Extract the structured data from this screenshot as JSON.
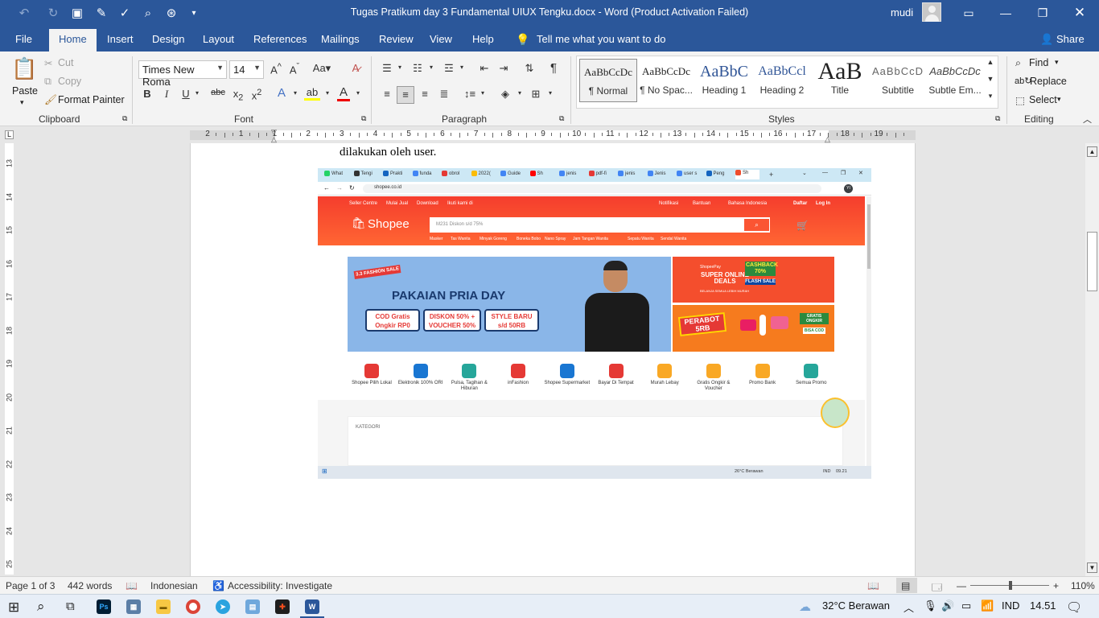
{
  "window": {
    "title": "Tugas Pratikum day 3 Fundamental UIUX Tengku.docx  -  Word (Product Activation Failed)",
    "user": "mudi"
  },
  "tabs": [
    "File",
    "Home",
    "Insert",
    "Design",
    "Layout",
    "References",
    "Mailings",
    "Review",
    "View",
    "Help"
  ],
  "tell_me": "Tell me what you want to do",
  "share": "Share",
  "clipboard": {
    "paste": "Paste",
    "cut": "Cut",
    "copy": "Copy",
    "format_painter": "Format Painter",
    "label": "Clipboard"
  },
  "font": {
    "name": "Times New Roma",
    "size": "14",
    "label": "Font"
  },
  "paragraph": {
    "label": "Paragraph"
  },
  "styles": {
    "label": "Styles",
    "items": [
      {
        "sample": "AaBbCcDc",
        "name": "¶ Normal"
      },
      {
        "sample": "AaBbCcDc",
        "name": "¶ No Spac..."
      },
      {
        "sample": "AaBbC",
        "name": "Heading 1"
      },
      {
        "sample": "AaBbCcl",
        "name": "Heading 2"
      },
      {
        "sample": "AaB",
        "name": "Title"
      },
      {
        "sample": "AaBbCcD",
        "name": "Subtitle"
      },
      {
        "sample": "AaBbCcDc",
        "name": "Subtle Em..."
      }
    ]
  },
  "editing": {
    "find": "Find",
    "replace": "Replace",
    "select": "Select",
    "label": "Editing"
  },
  "ruler": {
    "numbers": [
      "2",
      "1",
      "1",
      "2",
      "3",
      "4",
      "5",
      "6",
      "7",
      "8",
      "9",
      "10",
      "11",
      "12",
      "13",
      "14",
      "15",
      "16",
      "17",
      "18",
      "19"
    ]
  },
  "vruler": {
    "numbers": [
      "13",
      "14",
      "15",
      "16",
      "17",
      "18",
      "19",
      "20",
      "21",
      "22",
      "23",
      "24",
      "25"
    ]
  },
  "document": {
    "text": "dilakukan oleh user."
  },
  "screenshot": {
    "browser_tabs": [
      "What",
      "Tengi",
      "Prakti",
      "funda",
      "obrol",
      "2022(",
      "Guide",
      "Sh",
      "jenis",
      "pdf-fi",
      "jenis",
      "Jenis",
      "user s",
      "Peng",
      "Sh"
    ],
    "url": "shopee.co.id",
    "top_left": [
      "Seller Centre",
      "Mulai Jual",
      "Download",
      "Ikuti kami di"
    ],
    "top_right": [
      "Notifikasi",
      "Bantuan",
      "Bahasa Indonesia",
      "Daftar",
      "Log In"
    ],
    "logo": "Shopee",
    "search_placeholder": "M231 Diskon s/d 75%",
    "keywords": [
      "Masker",
      "Tas Wanita",
      "Minyak Goreng",
      "Boneka Bobo",
      "Nano Spray",
      "Jam Tangan Wanita",
      "Sepatu Wanita",
      "Sendal Wanita"
    ],
    "banner": {
      "tag": "3.3 FASHION SALE",
      "title": "PAKAIAN PRIA DAY",
      "boxes": [
        "COD Gratis Ongkir RP0",
        "DISKON 50% + VOUCHER 50%",
        "STYLE BARU s/d 50RB"
      ]
    },
    "side_banner_1": {
      "top": "ShopeePay",
      "main": "SUPER ONLINE DEALS",
      "sub": "BELANJA SEMUA LEBIH MURAH",
      "cashback": "CASHBACK 70%",
      "flash": "FLASH SALE"
    },
    "side_banner_2": {
      "main": "PERABOT 5RB",
      "right": "GRATIS ONGKIR",
      "cod": "BISA COD"
    },
    "categories": [
      "Shopee Pilih Lokal",
      "Elektronik 100% ORI",
      "Pulsa, Tagihan & Hiburan",
      "inFashion",
      "Shopee Supermarket",
      "Bayar Di Tempat",
      "Murah Lebay",
      "Gratis Ongkir & Voucher",
      "Promo Bank",
      "Semua Promo"
    ],
    "kategori": "KATEGORI",
    "taskbar_weather": "26°C  Berawan",
    "taskbar_lang": "IND",
    "taskbar_time": "09.21"
  },
  "status": {
    "page": "Page 1 of 3",
    "words": "442 words",
    "language": "Indonesian",
    "accessibility": "Accessibility: Investigate",
    "zoom": "110%"
  },
  "taskbar": {
    "weather": "32°C  Berawan",
    "lang": "IND",
    "time": "14.51"
  },
  "colors": {
    "word_blue": "#2b579a",
    "shopee_orange": "#f53d2d"
  }
}
